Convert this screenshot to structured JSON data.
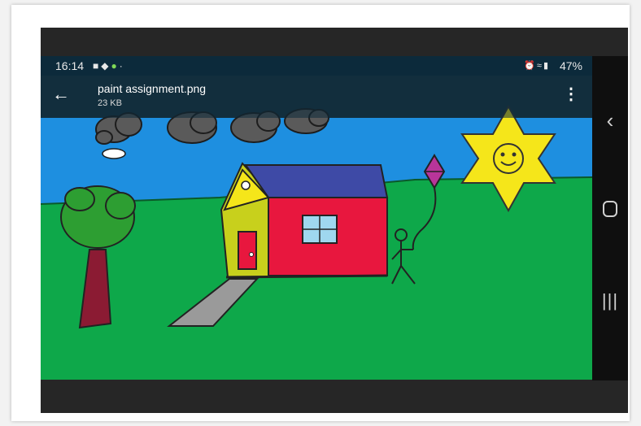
{
  "status_bar": {
    "time": "16:14",
    "left_icons": [
      "message-icon",
      "app-icon",
      "leaf-icon",
      "dot-icon"
    ],
    "right_icons": [
      "alarm-icon",
      "wifi-icon",
      "volte-icon",
      "signal-icon"
    ],
    "battery_percent": "47%"
  },
  "app_bar": {
    "back_icon": "arrow-left-icon",
    "file_name": "paint assignment.png",
    "file_size": "23 KB",
    "more_icon": "more-vertical-icon"
  },
  "nav_bar": {
    "buttons": [
      "nav-back-icon",
      "nav-home-icon",
      "nav-recents-icon"
    ]
  },
  "colors": {
    "sky": "#1e8fe0",
    "grass": "#0ea84a",
    "house_wall": "#e8173e",
    "house_roof": "#3e4aa6",
    "house_side": "#c8d01c",
    "sun": "#f5e61a",
    "kite": "#b8359a",
    "tree_leaves": "#2d9e32",
    "tree_trunk": "#8b1b33"
  }
}
